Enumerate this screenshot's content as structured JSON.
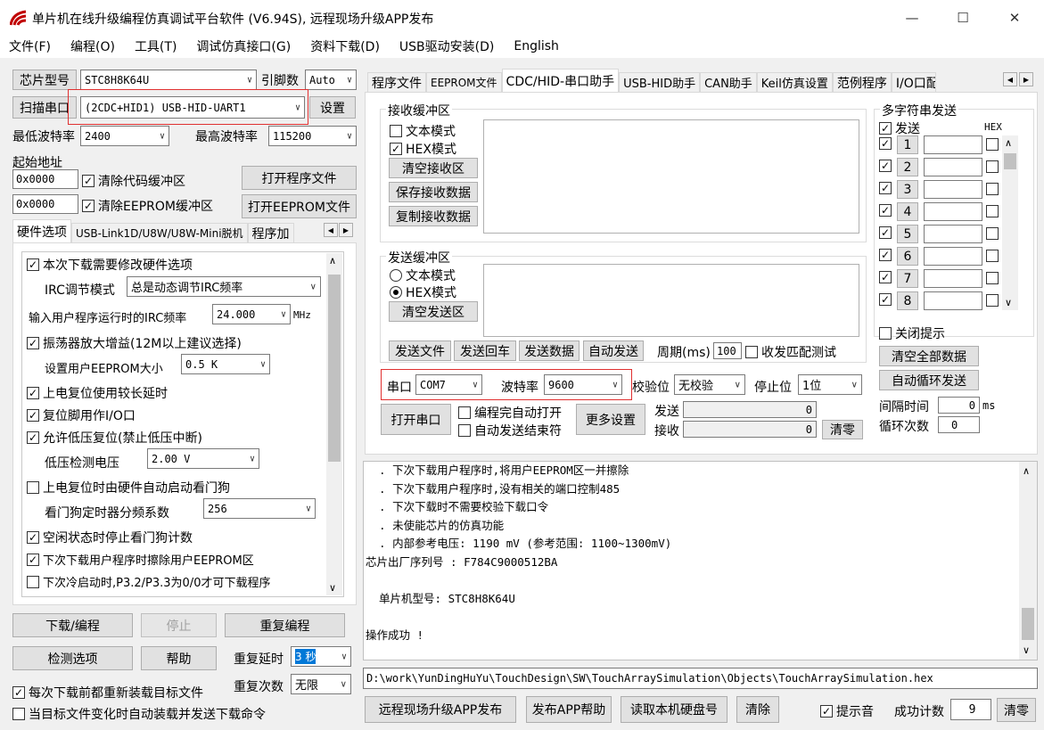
{
  "window": {
    "title": "单片机在线升级编程仿真调试平台软件 (V6.94S), 远程现场升级APP发布",
    "minimize": "—",
    "maximize": "☐",
    "close": "✕"
  },
  "menu": [
    "文件(F)",
    "编程(O)",
    "工具(T)",
    "调试仿真接口(G)",
    "资料下载(D)",
    "USB驱动安装(D)",
    "English"
  ],
  "left": {
    "chip_model_label": "芯片型号",
    "chip_model_value": "STC8H8K64U",
    "pin_count_label": "引脚数",
    "pin_count_value": "Auto",
    "scan_port_label": "扫描串口",
    "port_value": "(2CDC+HID1) USB-HID-UART1",
    "settings_label": "设置",
    "min_baud_label": "最低波特率",
    "min_baud_value": "2400",
    "max_baud_label": "最高波特率",
    "max_baud_value": "115200",
    "start_addr_label": "起始地址",
    "addr1": "0x0000",
    "clear_code_label": "清除代码缓冲区",
    "open_program_label": "打开程序文件",
    "addr2": "0x0000",
    "clear_eeprom_label": "清除EEPROM缓冲区",
    "open_eeprom_label": "打开EEPROM文件",
    "tabs": [
      "硬件选项",
      "USB-Link1D/U8W/U8W-Mini脱机",
      "程序加"
    ],
    "hw": {
      "opt_modify": "本次下载需要修改硬件选项",
      "irc_mode_label": "IRC调节模式",
      "irc_mode_value": "总是动态调节IRC频率",
      "irc_freq_label": "输入用户程序运行时的IRC频率",
      "irc_freq_value": "24.000",
      "irc_unit": "MHz",
      "osc_gain": "振荡器放大增益(12M以上建议选择)",
      "eeprom_size_label": "设置用户EEPROM大小",
      "eeprom_size_value": "0.5 K",
      "por_delay": "上电复位使用较长延时",
      "reset_io": "复位脚用作I/O口",
      "lvr": "允许低压复位(禁止低压中断)",
      "lvd_label": "低压检测电压",
      "lvd_value": "2.00 V",
      "wdt_auto": "上电复位时由硬件自动启动看门狗",
      "wdt_div_label": "看门狗定时器分频系数",
      "wdt_div_value": "256",
      "wdt_idle": "空闲状态时停止看门狗计数",
      "erase_eeprom": "下次下载用户程序时擦除用户EEPROM区",
      "p32": "下次冷启动时,P3.2/P3.3为0/0才可下载程序"
    },
    "download_label": "下载/编程",
    "stop_label": "停止",
    "reprogram_label": "重复编程",
    "check_label": "检测选项",
    "help_label": "帮助",
    "repeat_delay_label": "重复延时",
    "repeat_delay_value": "3 秒",
    "repeat_count_label": "重复次数",
    "repeat_count_value": "无限",
    "reload_each": "每次下载前都重新装载目标文件",
    "auto_on_change": "当目标文件变化时自动装载并发送下载命令"
  },
  "right": {
    "tabs": [
      "程序文件",
      "EEPROM文件",
      "CDC/HID-串口助手",
      "USB-HID助手",
      "CAN助手",
      "Keil仿真设置",
      "范例程序",
      "I/O口配置"
    ],
    "recv": {
      "title": "接收缓冲区",
      "text_mode": "文本模式",
      "hex_mode": "HEX模式",
      "clear": "清空接收区",
      "save": "保存接收数据",
      "copy": "复制接收数据"
    },
    "send": {
      "title": "发送缓冲区",
      "text_mode": "文本模式",
      "hex_mode": "HEX模式",
      "clear": "清空发送区",
      "send_file": "发送文件",
      "send_enter": "发送回车",
      "send_data": "发送数据",
      "auto_send": "自动发送",
      "period_label": "周期(ms)",
      "period_value": "100",
      "match_test": "收发匹配测试"
    },
    "port_label": "串口",
    "port_value": "COM7",
    "baud_label": "波特率",
    "baud_value": "9600",
    "parity_label": "校验位",
    "parity_value": "无校验",
    "stop_label": "停止位",
    "stop_value": "1位",
    "open_port": "打开串口",
    "auto_open": "编程完自动打开",
    "auto_send_end": "自动发送结束符",
    "more_settings": "更多设置",
    "tx_label": "发送",
    "tx_value": "0",
    "rx_label": "接收",
    "rx_value": "0",
    "clear_counts": "清零",
    "multi": {
      "title": "多字符串发送",
      "send_label": "发送",
      "hex_label": "HEX",
      "rows": [
        "1",
        "2",
        "3",
        "4",
        "5",
        "6",
        "7",
        "8"
      ],
      "close_tip": "关闭提示",
      "clear_all": "清空全部数据",
      "auto_loop": "自动循环发送",
      "interval_label": "间隔时间",
      "interval_value": "0",
      "interval_unit": "ms",
      "loop_label": "循环次数",
      "loop_value": "0"
    },
    "log": [
      "  . 下次下载用户程序时,将用户EEPROM区一并擦除",
      "  . 下次下载用户程序时,没有相关的端口控制485",
      "  . 下次下载时不需要校验下载口令",
      "  . 未使能芯片的仿真功能",
      "  . 内部参考电压: 1190 mV (参考范围: 1100~1300mV)",
      "芯片出厂序列号 : F784C9000512BA",
      "",
      "  单片机型号: STC8H8K64U",
      "",
      "操作成功 !"
    ],
    "file_path": "D:\\work\\YunDingHuYu\\TouchDesign\\SW\\TouchArraySimulation\\Objects\\TouchArraySimulation.hex",
    "remote_publish": "远程现场升级APP发布",
    "publish_help": "发布APP帮助",
    "read_disk": "读取本机硬盘号",
    "clear": "清除",
    "beep_label": "提示音",
    "success_label": "成功计数",
    "success_value": "9",
    "success_clear": "清零"
  }
}
